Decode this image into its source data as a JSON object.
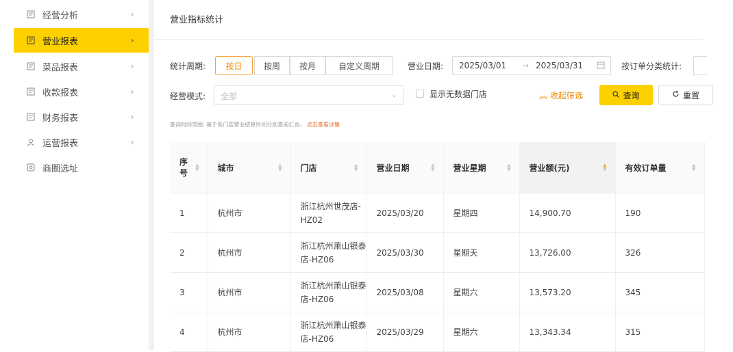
{
  "sidebar": {
    "items": [
      {
        "label": "经营分析",
        "active": false,
        "icon": "report-icon"
      },
      {
        "label": "营业报表",
        "active": true,
        "icon": "report-icon"
      },
      {
        "label": "菜品报表",
        "active": false,
        "icon": "report-icon"
      },
      {
        "label": "收款报表",
        "active": false,
        "icon": "report-icon"
      },
      {
        "label": "财务报表",
        "active": false,
        "icon": "report-icon"
      },
      {
        "label": "运营报表",
        "active": false,
        "icon": "user-icon"
      },
      {
        "label": "商圈选址",
        "active": false,
        "icon": "location-icon"
      }
    ]
  },
  "page": {
    "title": "营业指标统计"
  },
  "filters": {
    "period_label": "统计周期:",
    "period_options": [
      "按日",
      "按周",
      "按月",
      "自定义周期"
    ],
    "period_selected": "按日",
    "date_label": "营业日期:",
    "date_start": "2025/03/01",
    "date_sep": "→",
    "date_end": "2025/03/31",
    "order_cat_label": "按订单分类统计:",
    "mode_label": "经营模式:",
    "mode_placeholder": "全部",
    "show_empty_label": "显示无数据门店",
    "collapse_label": "收起筛选",
    "query_label": "查询",
    "reset_label": "重置",
    "hint_text": "查询时间范围: 基于各门店营业结算时间分别查询汇总。",
    "hint_link": "点击查看详情"
  },
  "table": {
    "columns": [
      "序号",
      "城市",
      "门店",
      "营业日期",
      "营业星期",
      "营业额(元)",
      "有效订单量"
    ],
    "rows": [
      {
        "seq": "1",
        "city": "杭州市",
        "store": "浙江杭州世茂店-HZ02",
        "date": "2025/03/20",
        "weekday": "星期四",
        "revenue": "14,900.70",
        "orders": "190"
      },
      {
        "seq": "2",
        "city": "杭州市",
        "store": "浙江杭州萧山银泰店-HZ06",
        "date": "2025/03/30",
        "weekday": "星期天",
        "revenue": "13,726.00",
        "orders": "326"
      },
      {
        "seq": "3",
        "city": "杭州市",
        "store": "浙江杭州萧山银泰店-HZ06",
        "date": "2025/03/08",
        "weekday": "星期六",
        "revenue": "13,573.20",
        "orders": "345"
      },
      {
        "seq": "4",
        "city": "杭州市",
        "store": "浙江杭州萧山银泰店-HZ06",
        "date": "2025/03/29",
        "weekday": "星期六",
        "revenue": "13,343.34",
        "orders": "315"
      }
    ]
  },
  "colors": {
    "accent": "#ffd000",
    "active_border": "#f7a334",
    "link": "#f06a2a"
  }
}
